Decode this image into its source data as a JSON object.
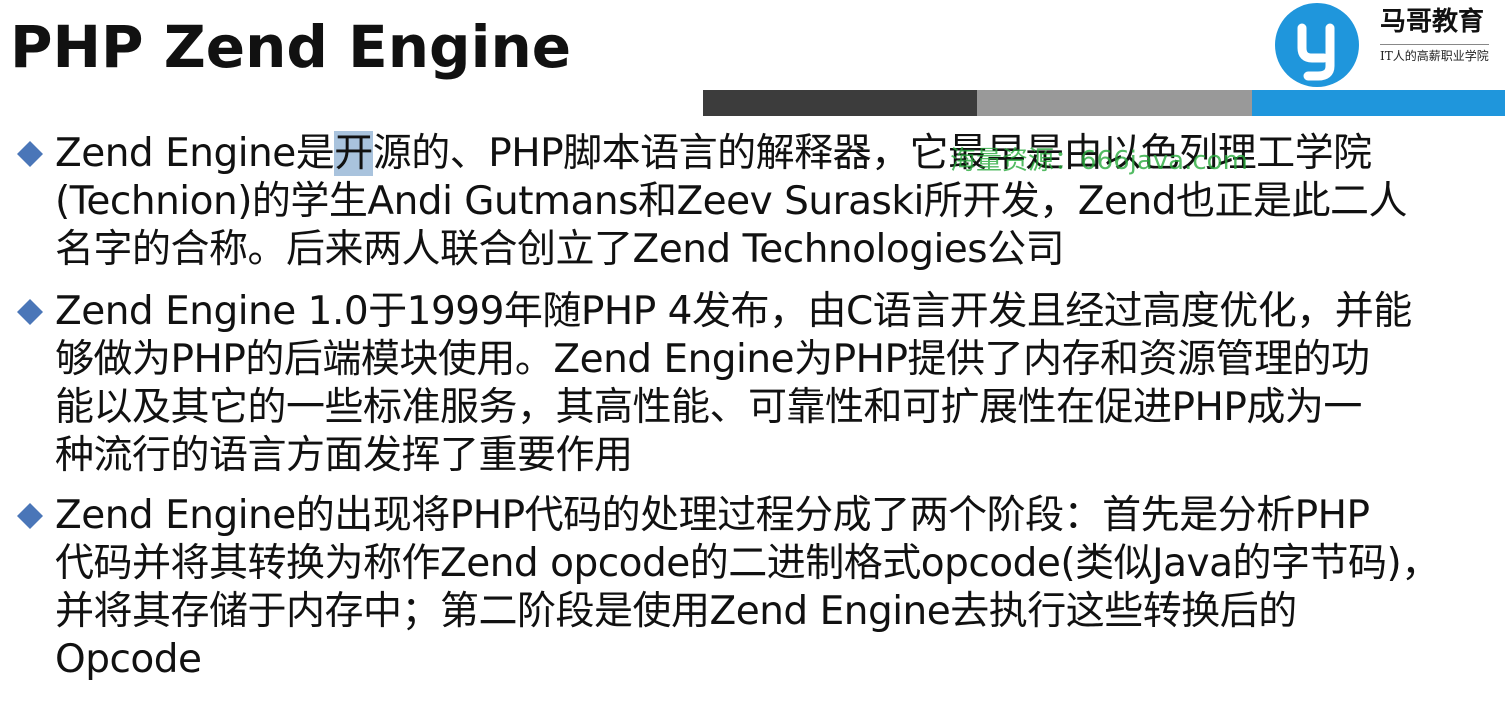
{
  "slide": {
    "title": "PHP Zend Engine"
  },
  "logo": {
    "brand": "马哥教育",
    "slogan": "IT人的高薪职业学院",
    "icon": "g-letter-logo-icon",
    "colors": {
      "circle": "#1f96dc",
      "letter": "#ffffff"
    }
  },
  "title_bar": {
    "colors": [
      "#3c3c3c",
      "#999999",
      "#1f96dc"
    ]
  },
  "watermark": {
    "text": "海量资源：666java.com"
  },
  "bullets": [
    {
      "marker_icon": "diamond-bullet-icon",
      "lines": [
        {
          "before": "Zend Engine是",
          "selected": "开",
          "after": "源的、PHP脚本语言的解释器，它最早是由以色列理工学院"
        },
        "(Technion)的学生Andi Gutmans和Zeev Suraski所开发，Zend也正是此二人",
        "名字的合称。后来两人联合创立了Zend Technologies公司"
      ]
    },
    {
      "marker_icon": "diamond-bullet-icon",
      "lines": [
        "Zend Engine 1.0于1999年随PHP 4发布，由C语言开发且经过高度优化，并能",
        "够做为PHP的后端模块使用。Zend Engine为PHP提供了内存和资源管理的功",
        "能以及其它的一些标准服务，其高性能、可靠性和可扩展性在促进PHP成为一",
        "种流行的语言方面发挥了重要作用"
      ]
    },
    {
      "marker_icon": "diamond-bullet-icon",
      "lines": [
        "Zend Engine的出现将PHP代码的处理过程分成了两个阶段：首先是分析PHP",
        "代码并将其转换为称作Zend opcode的二进制格式opcode(类似Java的字节码)，",
        "并将其存储于内存中；第二阶段是使用Zend Engine去执行这些转换后的",
        "Opcode"
      ]
    }
  ],
  "colors": {
    "bullet_marker": "#4a76b8",
    "text": "#111111",
    "selection": "#a9c3dd",
    "watermark": "#28aa3c"
  }
}
